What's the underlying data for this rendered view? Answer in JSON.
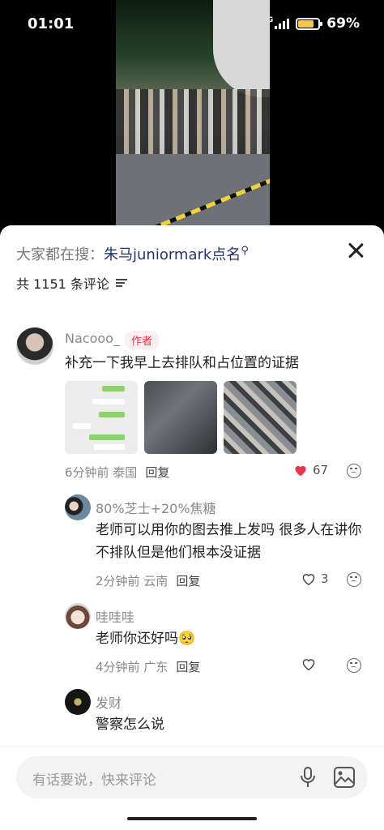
{
  "status_bar": {
    "time": "01:01",
    "network": "4G",
    "battery": "69%"
  },
  "header": {
    "search_prefix": "大家都在搜：",
    "search_keyword": "朱马juniormark点名",
    "comment_count": "共 1151 条评论"
  },
  "comments": [
    {
      "username": "Nacooo_",
      "tag": "作者",
      "text": "补充一下我早上去排队和占位置的证据",
      "meta": "6分钟前 泰国",
      "reply": "回复",
      "likes": "67",
      "liked": true,
      "image_count": 3
    },
    {
      "username": "80%芝士+20%焦糖",
      "text": "老师可以用你的图去推上发吗 很多人在讲你不排队但是他们根本没证据",
      "meta": "2分钟前 云南",
      "reply": "回复",
      "likes": "3"
    },
    {
      "username": "哇哇哇",
      "text": "老师你还好吗🥺",
      "meta": "4分钟前 广东",
      "reply": "回复"
    },
    {
      "username": "发财",
      "text": "警察怎么说"
    }
  ],
  "input": {
    "placeholder": "有话要说，快来评论"
  },
  "colors": {
    "accent_red": "#e8364b",
    "keyword_blue": "#24356b"
  },
  "icons": [
    "close-icon",
    "sort-icon",
    "heart-icon",
    "dislike-icon",
    "microphone-icon",
    "image-icon"
  ]
}
